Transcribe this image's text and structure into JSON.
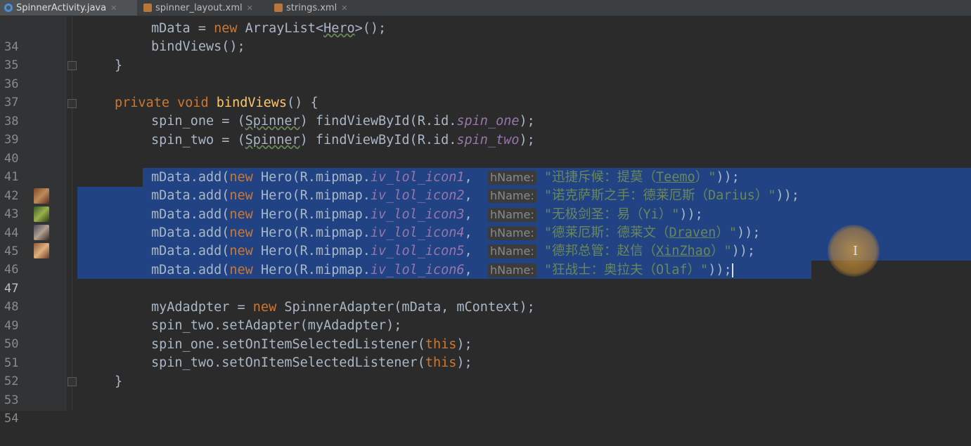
{
  "tabs": [
    {
      "label": "SpinnerActivity.java",
      "icon": "java-class-icon",
      "active": true
    },
    {
      "label": "spinner_layout.xml",
      "icon": "xml-file-icon",
      "active": false
    },
    {
      "label": "strings.xml",
      "icon": "xml-file-icon",
      "active": false
    }
  ],
  "lines": {
    "l34": {
      "num": "34",
      "a": "mData = ",
      "b": "new",
      "c": " ArrayList<",
      "d": "Hero",
      "e": ">();"
    },
    "l35": {
      "num": "35",
      "a": "bindViews();"
    },
    "l36": {
      "num": "36",
      "a": "}"
    },
    "l37": {
      "num": "37"
    },
    "l38": {
      "num": "38",
      "a": "private void",
      "b": " ",
      "c": "bindViews",
      "d": "() {"
    },
    "l39": {
      "num": "39",
      "a": "spin_one = (",
      "b": "Spinner",
      "c": ") findViewById(R.id.",
      "d": "spin_one",
      "e": ");"
    },
    "l40": {
      "num": "40",
      "a": "spin_two = (",
      "b": "Spinner",
      "c": ") findViewById(R.id.",
      "d": "spin_two",
      "e": ");"
    },
    "l41": {
      "num": "41"
    },
    "l42": {
      "num": "42",
      "a": "mData.add(",
      "b": "new",
      "c": " Hero(R.mipmap.",
      "d": "iv_lol_icon1",
      "e": ",  ",
      "hint": "hName:",
      "s1": "\"迅捷斥候：提莫（",
      "s2": "Teemo",
      "s3": "）\"",
      "f": "));"
    },
    "l43": {
      "num": "43",
      "a": "mData.add(",
      "b": "new",
      "c": " Hero(R.mipmap.",
      "d": "iv_lol_icon2",
      "e": ",  ",
      "hint": "hName:",
      "s1": "\"诺克萨斯之手：德莱厄斯（",
      "s2": "Darius",
      "s3": "）\"",
      "f": "));"
    },
    "l44": {
      "num": "44",
      "a": "mData.add(",
      "b": "new",
      "c": " Hero(R.mipmap.",
      "d": "iv_lol_icon3",
      "e": ",  ",
      "hint": "hName:",
      "s1": "\"无极剑圣：易（",
      "s2": "Yi",
      "s3": "）\"",
      "f": "));"
    },
    "l45": {
      "num": "45",
      "a": "mData.add(",
      "b": "new",
      "c": " Hero(R.mipmap.",
      "d": "iv_lol_icon4",
      "e": ",  ",
      "hint": "hName:",
      "s1": "\"德莱厄斯：德莱文（",
      "s2": "Draven",
      "s3": "）\"",
      "f": "));"
    },
    "l46": {
      "num": "46",
      "a": "mData.add(",
      "b": "new",
      "c": " Hero(R.mipmap.",
      "d": "iv_lol_icon5",
      "e": ",  ",
      "hint": "hName:",
      "s1": "\"德邦总管：赵信（",
      "s2": "XinZhao",
      "s3": "）\"",
      "f": "));"
    },
    "l47": {
      "num": "47",
      "a": "mData.add(",
      "b": "new",
      "c": " Hero(R.mipmap.",
      "d": "iv_lol_icon6",
      "e": ",  ",
      "hint": "hName:",
      "s1": "\"狂战士：奥拉夫（",
      "s2": "Olaf",
      "s3": "）\"",
      "f": "));"
    },
    "l48": {
      "num": "48"
    },
    "l49": {
      "num": "49",
      "a": "myAdadpter = ",
      "b": "new",
      "c": " SpinnerAdapter(mData, mContext);"
    },
    "l50": {
      "num": "50",
      "a": "spin_two.setAdapter(myAdadpter);"
    },
    "l51": {
      "num": "51",
      "a": "spin_one.setOnItemSelectedListener(",
      "b": "this",
      "c": ");"
    },
    "l52": {
      "num": "52",
      "a": "spin_two.setOnItemSelectedListener(",
      "b": "this",
      "c": ");"
    },
    "l53": {
      "num": "53",
      "a": "}"
    },
    "l54": {
      "num": "54"
    }
  },
  "colors": {
    "background": "#2b2b2b",
    "selection": "#214283",
    "keyword": "#cc7832",
    "method": "#ffc66d",
    "field": "#9876aa",
    "string": "#6a8759"
  }
}
